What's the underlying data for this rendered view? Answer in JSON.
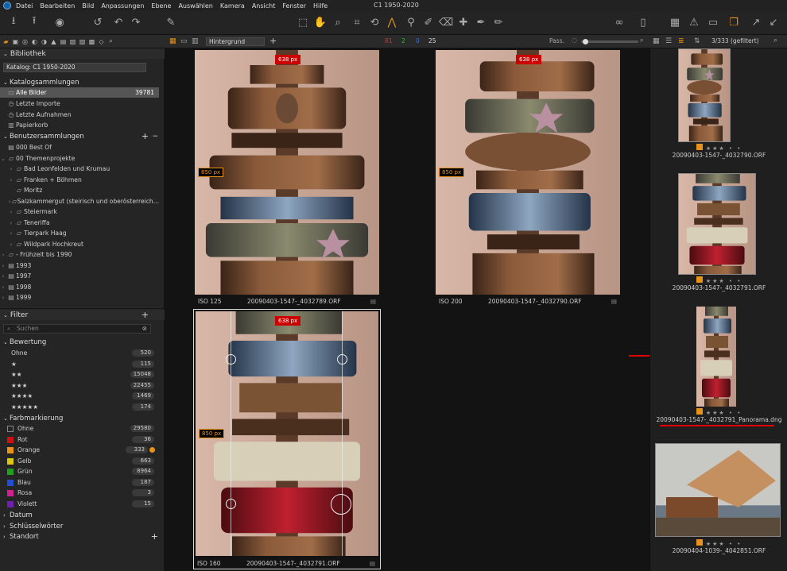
{
  "app": {
    "window_title": "C1 1950-2020"
  },
  "menu": [
    {
      "label": "Datei"
    },
    {
      "label": "Bearbeiten"
    },
    {
      "label": "Bild"
    },
    {
      "label": "Anpassungen"
    },
    {
      "label": "Ebene"
    },
    {
      "label": "Auswählen"
    },
    {
      "label": "Kamera"
    },
    {
      "label": "Ansicht"
    },
    {
      "label": "Fenster"
    },
    {
      "label": "Hilfe"
    }
  ],
  "viewer_toolbar": {
    "layer": "Hintergrund",
    "counts": {
      "red": "81",
      "green": "2",
      "blue": "0",
      "white": "25"
    },
    "pass_label": "Pass.",
    "zoom_fraction": 0.05
  },
  "browser_toolbar": {
    "count": "3/333 (gefiltert)"
  },
  "colors": {
    "accent": "#e8921a",
    "red_line": "#e00000"
  },
  "library": {
    "title": "Bibliothek",
    "catalog": "Katalog: C1 1950-2020",
    "catalog_collections": {
      "title": "Katalogsammlungen",
      "items": [
        {
          "label": "Alle Bilder",
          "count": "39781"
        },
        {
          "label": "Letzte Importe"
        },
        {
          "label": "Letzte Aufnahmen"
        },
        {
          "label": "Papierkorb"
        }
      ]
    },
    "user_collections": {
      "title": "Benutzersammlungen",
      "items": [
        {
          "label": "000 Best Of"
        },
        {
          "label": "00 Themenprojekte"
        },
        {
          "label": "Bad Leonfelden und Krumau"
        },
        {
          "label": "Franken + Böhmen"
        },
        {
          "label": "Moritz"
        },
        {
          "label": "Salzkammergut (steirisch und oberösterreich..."
        },
        {
          "label": "Steiermark"
        },
        {
          "label": "Teneriffa"
        },
        {
          "label": "Tierpark Haag"
        },
        {
          "label": "Wildpark Hochkreut"
        },
        {
          "label": "- Frühzeit bis 1990"
        },
        {
          "label": "1993"
        },
        {
          "label": "1997"
        },
        {
          "label": "1998"
        },
        {
          "label": "1999"
        }
      ]
    }
  },
  "filter": {
    "title": "Filter",
    "search_placeholder": "Suchen",
    "rating": {
      "title": "Bewertung",
      "items": [
        {
          "label": "Ohne",
          "count": "520"
        },
        {
          "label": "★",
          "count": "115"
        },
        {
          "label": "★★",
          "count": "15048"
        },
        {
          "label": "★★★",
          "count": "22455"
        },
        {
          "label": "★★★★",
          "count": "1469"
        },
        {
          "label": "★★★★★",
          "count": "174"
        }
      ]
    },
    "color": {
      "title": "Farbmarkierung",
      "items": [
        {
          "label": "Ohne",
          "count": "29580",
          "color": "transparent"
        },
        {
          "label": "Rot",
          "count": "36",
          "color": "#d01010"
        },
        {
          "label": "Orange",
          "count": "333",
          "color": "#e8921a"
        },
        {
          "label": "Gelb",
          "count": "663",
          "color": "#d8c810"
        },
        {
          "label": "Grün",
          "count": "8964",
          "color": "#20a020"
        },
        {
          "label": "Blau",
          "count": "187",
          "color": "#2050d0"
        },
        {
          "label": "Rosa",
          "count": "3",
          "color": "#d02090"
        },
        {
          "label": "Violett",
          "count": "15",
          "color": "#7020b0"
        }
      ]
    },
    "other": [
      {
        "label": "Datum"
      },
      {
        "label": "Schlüsselwörter"
      },
      {
        "label": "Standort"
      }
    ]
  },
  "viewer": {
    "cells": [
      {
        "iso": "ISO 125",
        "file": "20090403-1547-_4032789.ORF",
        "w": "638 px",
        "h": "850 px"
      },
      {
        "iso": "ISO 200",
        "file": "20090403-1547-_4032790.ORF",
        "w": "638 px",
        "h": "850 px"
      },
      {
        "iso": "ISO 160",
        "file": "20090403-1547-_4032791.ORF",
        "w": "638 px",
        "h": "850 px"
      }
    ]
  },
  "browser": {
    "thumbs": [
      {
        "file": "20090403-1547-_4032790.ORF",
        "rating": 3
      },
      {
        "file": "20090403-1547-_4032791.ORF",
        "rating": 3
      },
      {
        "file": "20090403-1547-_4032791_Panorama.dng",
        "rating": 3
      },
      {
        "file": "20090404-1039-_4042851.ORF",
        "rating": 3
      }
    ]
  }
}
